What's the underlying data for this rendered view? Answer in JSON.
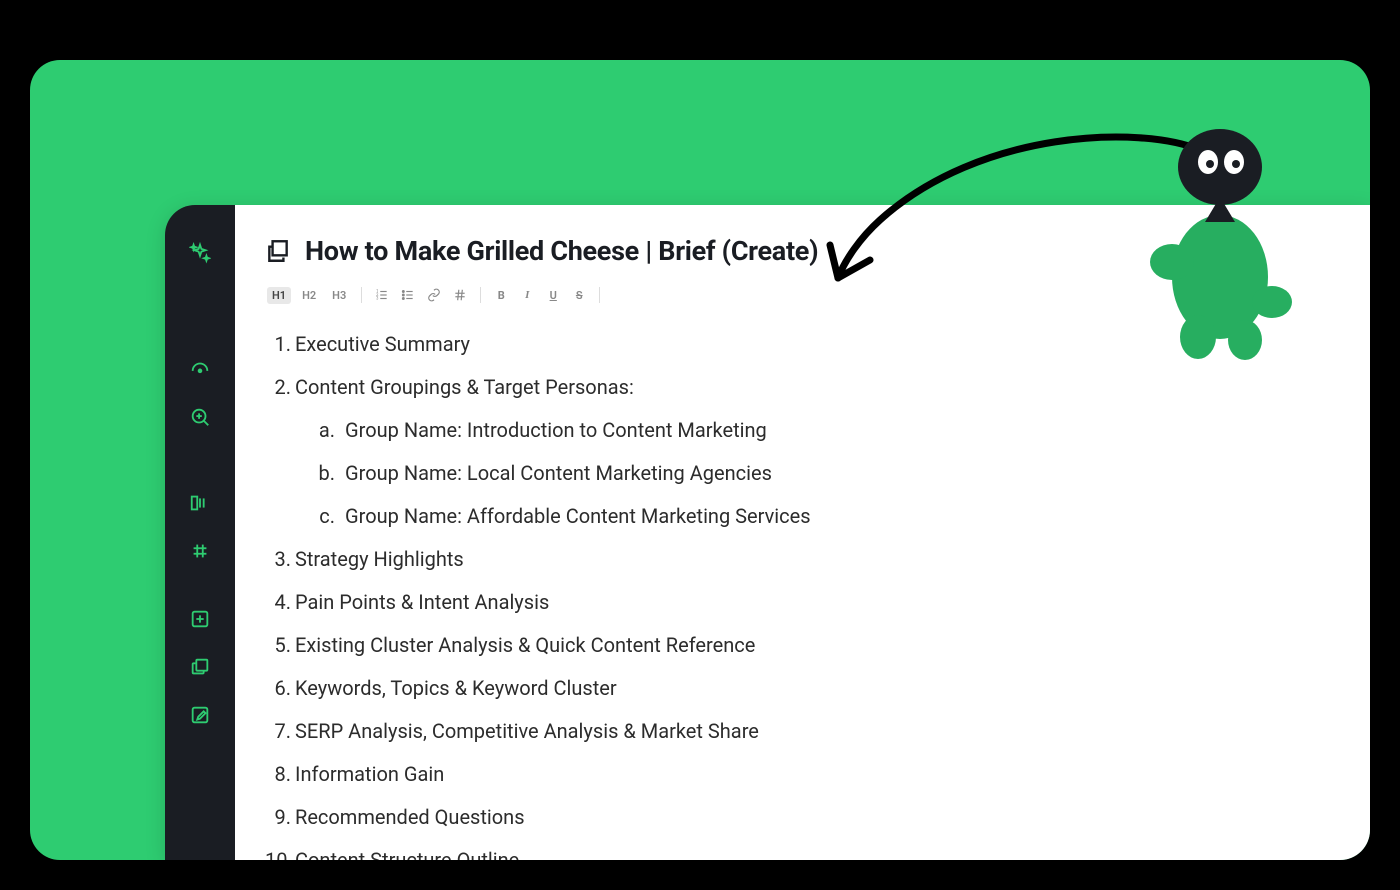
{
  "page": {
    "title": "How to Make Grilled Cheese | Brief (Create)"
  },
  "toolbar": {
    "h1": "H1",
    "h2": "H2",
    "h3": "H3",
    "bold": "B",
    "italic": "I",
    "underline": "U",
    "strike": "S"
  },
  "outline": {
    "items": [
      {
        "text": "Executive Summary"
      },
      {
        "text": "Content Groupings & Target Personas:",
        "children": [
          {
            "text": "Group Name: Introduction to Content Marketing"
          },
          {
            "text": "Group Name: Local Content Marketing Agencies"
          },
          {
            "text": "Group Name: Affordable Content Marketing Services"
          }
        ]
      },
      {
        "text": "Strategy Highlights"
      },
      {
        "text": "Pain Points & Intent Analysis"
      },
      {
        "text": "Existing Cluster Analysis & Quick Content Reference"
      },
      {
        "text": "Keywords, Topics & Keyword Cluster"
      },
      {
        "text": "SERP Analysis, Competitive Analysis & Market Share"
      },
      {
        "text": "Information Gain"
      },
      {
        "text": "Recommended Questions"
      },
      {
        "text": "Content Structure Outline"
      }
    ]
  },
  "sidebar": {
    "icons": [
      "sparkles-icon",
      "speedometer-icon",
      "search-zoom-icon",
      "columns-icon",
      "hash-icon",
      "plus-square-icon",
      "copy-stack-icon",
      "edit-note-icon"
    ]
  }
}
